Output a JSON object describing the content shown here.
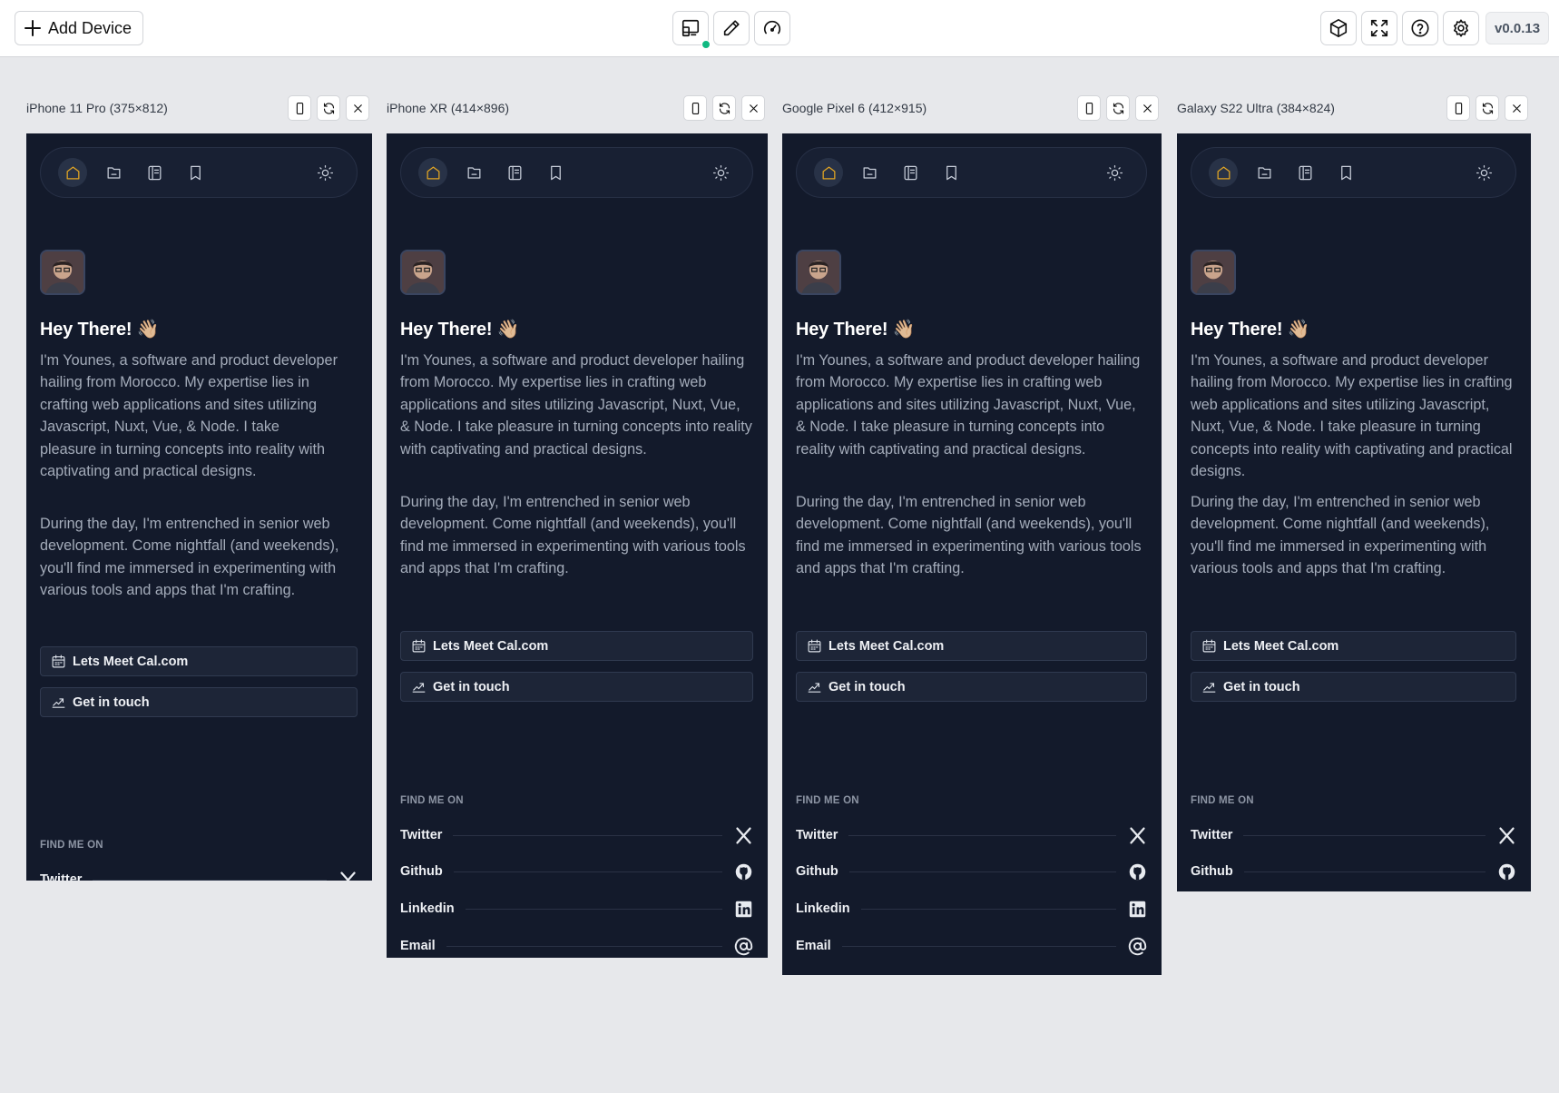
{
  "toolbar": {
    "add_device_label": "Add Device",
    "version": "v0.0.13",
    "icons": [
      "responsive-layout-icon",
      "pencil-icon",
      "speedometer-icon",
      "cube-icon",
      "fullscreen-icon",
      "help-icon",
      "settings-icon"
    ],
    "status_color": "#10b981"
  },
  "content": {
    "heading": "Hey There! 👋🏼",
    "paragraph1": "I'm Younes, a software and product developer hailing from Morocco. My expertise lies in crafting web applications and sites utilizing Javascript, Nuxt, Vue, & Node. I take pleasure in turning concepts into reality with captivating and practical designs.",
    "paragraph2": "During the day, I'm entrenched in senior web development. Come nightfall (and weekends), you'll find me immersed in experimenting with various tools and apps that I'm crafting.",
    "button_meet": "Lets Meet Cal.com",
    "button_contact": "Get in touch",
    "find_me": "FIND ME ON",
    "socials": [
      "Twitter",
      "Github",
      "Linkedin",
      "Email"
    ]
  },
  "devices": [
    {
      "title": "iPhone 11 Pro (375×812)",
      "visible_socials": [
        "Twitter"
      ]
    },
    {
      "title": "iPhone XR (414×896)",
      "visible_socials": [
        "Twitter",
        "Github",
        "Linkedin",
        "Email"
      ]
    },
    {
      "title": "Google Pixel 6 (412×915)",
      "visible_socials": [
        "Twitter",
        "Github",
        "Linkedin",
        "Email"
      ]
    },
    {
      "title": "Galaxy S22 Ultra (384×824)",
      "visible_socials": [
        "Twitter",
        "Github"
      ]
    }
  ],
  "colors": {
    "page_bg": "#e7e8eb",
    "screen_bg": "#131a2b",
    "accent": "#e2a523",
    "body_text": "#a4acba"
  }
}
